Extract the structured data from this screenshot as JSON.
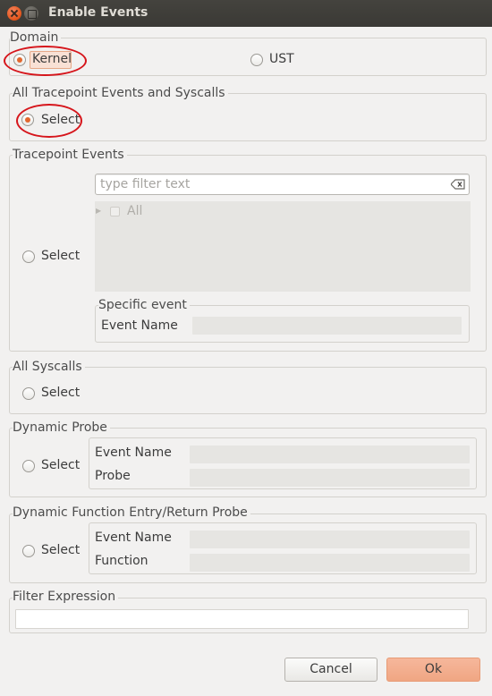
{
  "window": {
    "title": "Enable Events"
  },
  "domain": {
    "label": "Domain",
    "kernel_label": "Kernel",
    "ust_label": "UST",
    "selected": "Kernel"
  },
  "all_tracepoints": {
    "label": "All Tracepoint Events and Syscalls",
    "select_label": "Select",
    "selected": true
  },
  "tracepoint_events": {
    "label": "Tracepoint Events",
    "select_label": "Select",
    "filter_placeholder": "type filter text",
    "tree_items": [
      "All"
    ],
    "specific_event_label": "Specific event",
    "event_name_label": "Event Name",
    "event_name_value": ""
  },
  "all_syscalls": {
    "label": "All Syscalls",
    "select_label": "Select"
  },
  "dynamic_probe": {
    "label": "Dynamic Probe",
    "select_label": "Select",
    "event_name_label": "Event Name",
    "probe_label": "Probe",
    "event_name_value": "",
    "probe_value": ""
  },
  "dynamic_function": {
    "label": "Dynamic Function Entry/Return Probe",
    "select_label": "Select",
    "event_name_label": "Event Name",
    "function_label": "Function",
    "event_name_value": "",
    "function_value": ""
  },
  "filter_expression": {
    "label": "Filter Expression",
    "value": ""
  },
  "buttons": {
    "cancel": "Cancel",
    "ok": "Ok"
  },
  "colors": {
    "accent": "#e2672e",
    "annotation": "#d6151b",
    "ok_button": "#f0a683"
  }
}
